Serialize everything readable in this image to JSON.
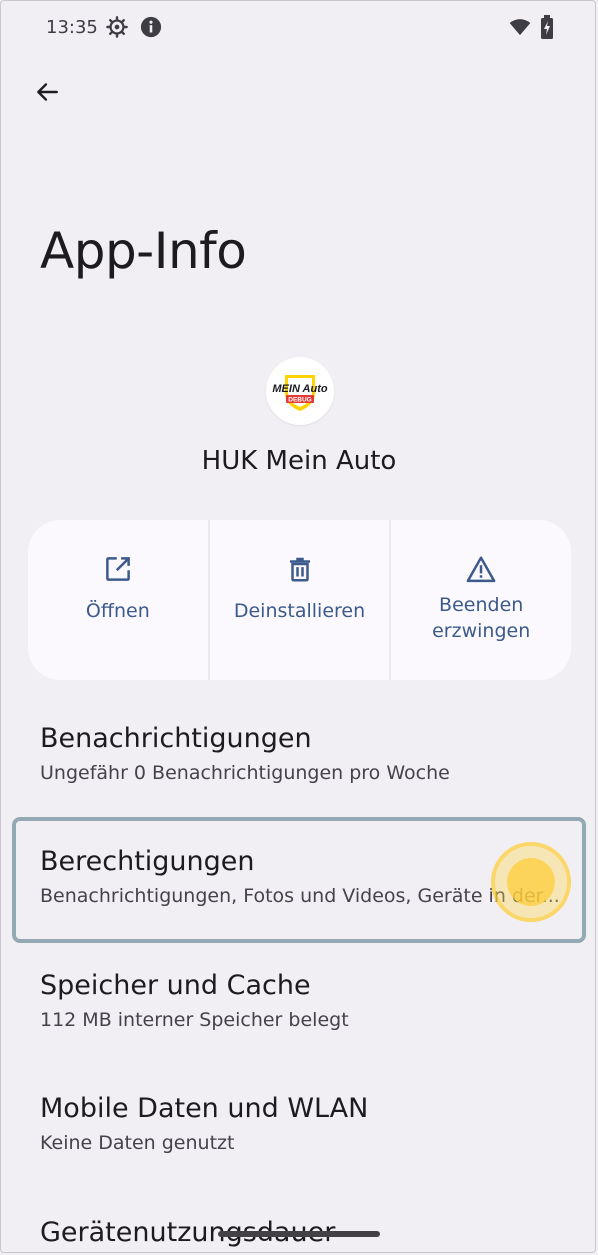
{
  "statusbar": {
    "time": "13:35"
  },
  "page": {
    "title": "App-Info"
  },
  "app": {
    "name": "HUK Mein Auto",
    "icon_text_top": "MEIN Auto",
    "icon_text_badge": "DEBUG"
  },
  "actions": [
    {
      "label": "Öffnen",
      "icon": "open-external-icon"
    },
    {
      "label": "Deinstallieren",
      "icon": "trash-icon"
    },
    {
      "label_line1": "Beenden",
      "label_line2": "erzwingen",
      "icon": "warning-icon"
    }
  ],
  "settings": [
    {
      "title": "Benachrichtigungen",
      "subtitle": "Ungefähr 0 Benachrichtigungen pro Woche"
    },
    {
      "title": "Berechtigungen",
      "subtitle": "Benachrichtigungen, Fotos und Videos, Geräte in der..."
    },
    {
      "title": "Speicher und Cache",
      "subtitle": "112 MB interner Speicher belegt"
    },
    {
      "title": "Mobile Daten und WLAN",
      "subtitle": "Keine Daten genutzt"
    },
    {
      "title": "Gerätenutzungsdauer"
    }
  ],
  "colors": {
    "accent": "#3c5a8c",
    "background": "#f1eff4",
    "highlight": "#93aab2"
  }
}
